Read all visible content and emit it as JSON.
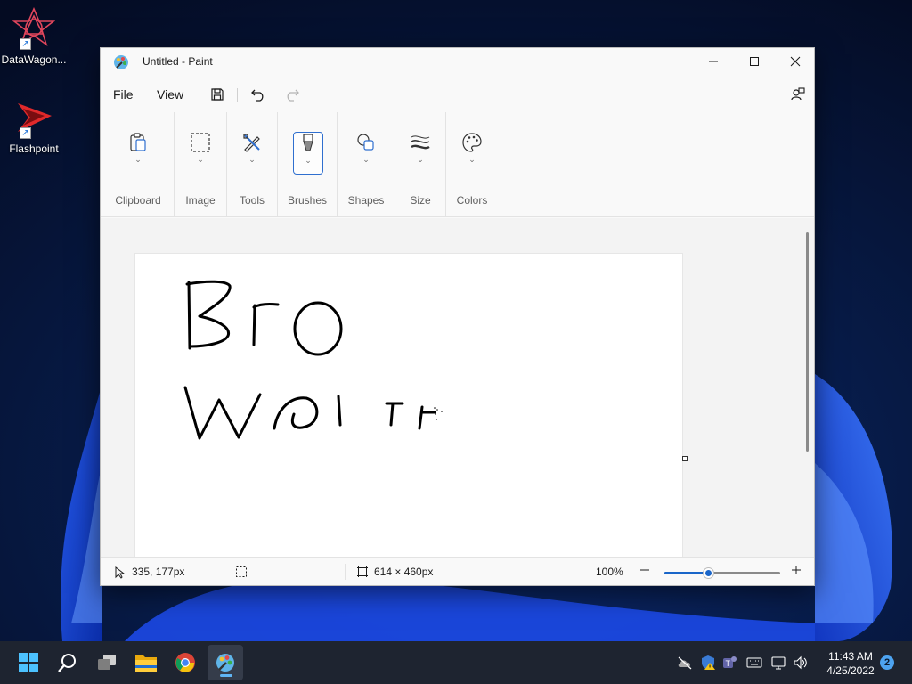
{
  "desktop": {
    "icons": [
      {
        "label": "DataWagon...",
        "icon": "datawagon-icon"
      },
      {
        "label": "Flashpoint",
        "icon": "flashpoint-icon"
      }
    ]
  },
  "window": {
    "title": "Untitled - Paint",
    "controls": {
      "minimize": "—",
      "maximize": "☐",
      "close": "✕"
    },
    "menu": {
      "file": "File",
      "view": "View"
    },
    "quick_access": [
      "save-icon",
      "undo-icon",
      "redo-icon"
    ],
    "ribbon": {
      "groups": [
        {
          "label": "Clipboard",
          "icon": "clipboard-icon"
        },
        {
          "label": "Image",
          "icon": "selection-icon"
        },
        {
          "label": "Tools",
          "icon": "tools-icon"
        },
        {
          "label": "Brushes",
          "icon": "brush-icon",
          "active": true
        },
        {
          "label": "Shapes",
          "icon": "shapes-icon"
        },
        {
          "label": "Size",
          "icon": "size-icon"
        },
        {
          "label": "Colors",
          "icon": "palette-icon"
        }
      ]
    },
    "canvas": {
      "drawn_text_line1": "Bro",
      "drawn_text_line2": "Wol TF"
    },
    "status": {
      "cursor_position": "335, 177px",
      "canvas_size": "614 × 460px",
      "zoom": "100%",
      "zoom_minus": "—",
      "zoom_plus": "+",
      "zoom_fraction": 0.38
    }
  },
  "taskbar": {
    "apps": [
      "start-icon",
      "search-icon",
      "task-view-icon",
      "file-explorer-icon",
      "chrome-icon",
      "paint-icon"
    ],
    "clock_time": "11:43 AM",
    "clock_date": "4/25/2022",
    "notification_count": "2"
  },
  "colors": {
    "accent": "#1a66c9",
    "taskbar": "#1e2430",
    "wallpaper": "#06122e"
  }
}
